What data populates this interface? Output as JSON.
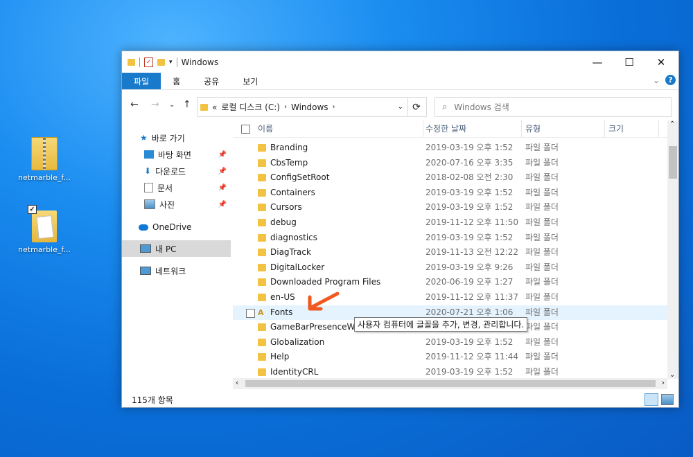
{
  "desktop": {
    "icons": [
      {
        "label": "netmarble_f..."
      },
      {
        "label": "netmarble_f..."
      }
    ]
  },
  "window": {
    "title": "Windows",
    "controls": {
      "minimize": "—",
      "maximize": "☐",
      "close": "✕"
    },
    "ribbon_tabs": [
      "파일",
      "홈",
      "공유",
      "보기"
    ],
    "address": {
      "prefix": "«",
      "segments": [
        "로컬 디스크 (C:)",
        "Windows"
      ]
    },
    "search_placeholder": "Windows 검색",
    "columns": {
      "name": "이름",
      "date": "수정한 날짜",
      "type": "유형",
      "size": "크기"
    },
    "nav": {
      "quick_access": "바로 가기",
      "desktop": "바탕 화면",
      "downloads": "다운로드",
      "documents": "문서",
      "pictures": "사진",
      "onedrive": "OneDrive",
      "this_pc": "내 PC",
      "network": "네트워크"
    },
    "files": [
      {
        "name": "Branding",
        "date": "2019-03-19 오후 1:52",
        "type": "파일 폴더"
      },
      {
        "name": "CbsTemp",
        "date": "2020-07-16 오후 3:35",
        "type": "파일 폴더"
      },
      {
        "name": "ConfigSetRoot",
        "date": "2018-02-08 오전 2:30",
        "type": "파일 폴더"
      },
      {
        "name": "Containers",
        "date": "2019-03-19 오후 1:52",
        "type": "파일 폴더"
      },
      {
        "name": "Cursors",
        "date": "2019-03-19 오후 1:52",
        "type": "파일 폴더"
      },
      {
        "name": "debug",
        "date": "2019-11-12 오후 11:50",
        "type": "파일 폴더"
      },
      {
        "name": "diagnostics",
        "date": "2019-03-19 오후 1:52",
        "type": "파일 폴더"
      },
      {
        "name": "DiagTrack",
        "date": "2019-11-13 오전 12:22",
        "type": "파일 폴더"
      },
      {
        "name": "DigitalLocker",
        "date": "2019-03-19 오후 9:26",
        "type": "파일 폴더"
      },
      {
        "name": "Downloaded Program Files",
        "date": "2020-06-19 오후 1:27",
        "type": "파일 폴더"
      },
      {
        "name": "en-US",
        "date": "2019-11-12 오후 11:37",
        "type": "파일 폴더"
      },
      {
        "name": "Fonts",
        "date": "2020-07-21 오후 1:06",
        "type": "파일 폴더"
      },
      {
        "name": "GameBarPresenceWrit",
        "date": "",
        "type": "파일 폴더"
      },
      {
        "name": "Globalization",
        "date": "2019-03-19 오후 1:52",
        "type": "파일 폴더"
      },
      {
        "name": "Help",
        "date": "2019-11-12 오후 11:44",
        "type": "파일 폴더"
      },
      {
        "name": "IdentityCRL",
        "date": "2019-03-19 오후 1:52",
        "type": "파일 폴더"
      }
    ],
    "tooltip": "사용자 컴퓨터에 글꼴을 추가, 변경, 관리합니다.",
    "status": "115개 항목"
  },
  "colors": {
    "accent": "#1979ca",
    "hover_row": "#e5f3ff",
    "arrow": "#f05a22"
  }
}
